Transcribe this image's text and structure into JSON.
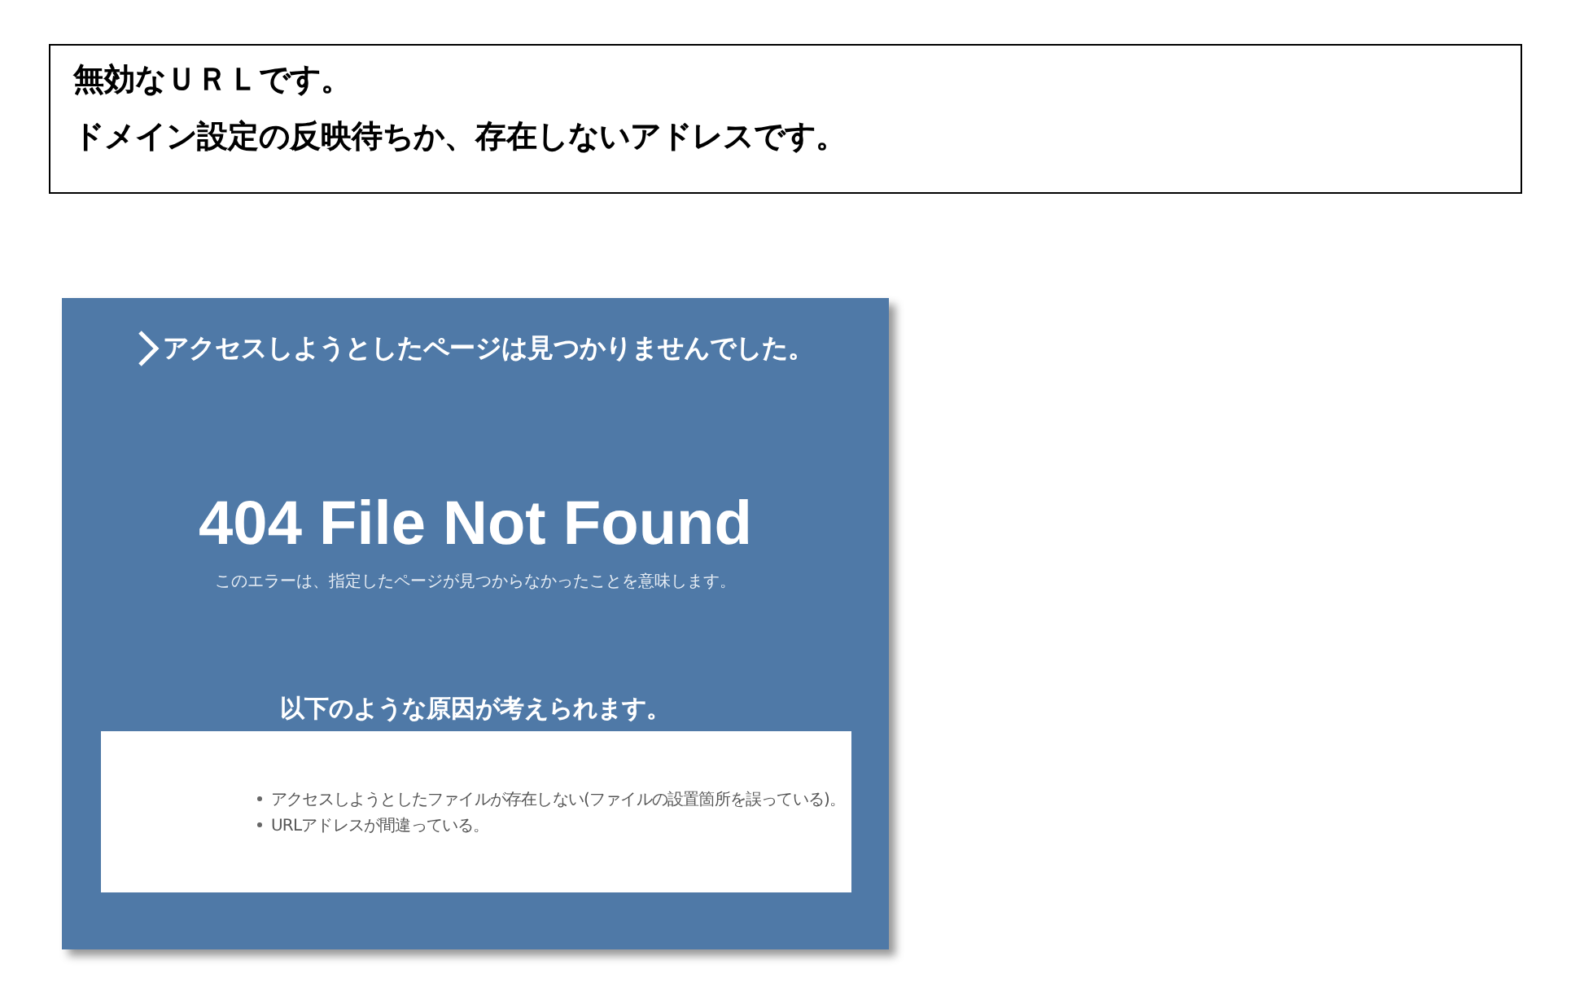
{
  "notice": {
    "lines": [
      "無効なＵＲＬです。",
      "ドメイン設定の反映待ちか、存在しないアドレスです。"
    ]
  },
  "screenshot": {
    "heading": "アクセスしようとしたページは見つかりませんでした。",
    "title": "404 File Not Found",
    "description": "このエラーは、指定したページが見つからなかったことを意味します。",
    "causes_heading": "以下のような原因が考えられます。",
    "causes": [
      "アクセスしようとしたファイルが存在しない(ファイルの設置箇所を誤っている)。",
      "URLアドレスが間違っている。"
    ]
  }
}
